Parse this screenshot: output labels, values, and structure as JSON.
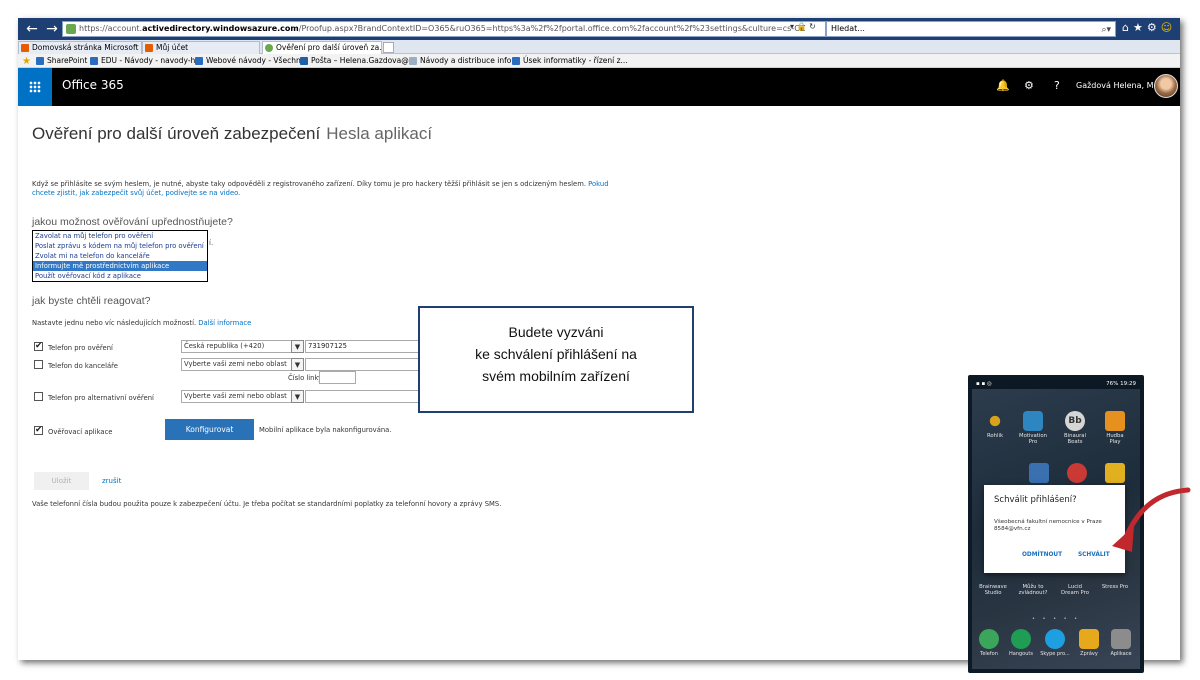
{
  "browser": {
    "url_prefix": "https://account.",
    "url_domain": "activedirectory.windowsazure.com",
    "url_rest": "/Proofup.aspx?BrandContextID=O365&ruO365=https%3a%2f%2fportal.office.com%2faccount%2f%23settings&culture=cs-CZ",
    "search_text": "Hledat...",
    "tabs": [
      {
        "label": "Domovská stránka Microsoft O..."
      },
      {
        "label": "Můj účet"
      },
      {
        "label": "Ověření pro další úroveň za..."
      }
    ],
    "favorites": [
      {
        "label": "SharePoint"
      },
      {
        "label": "EDU - Návody - navody-h..."
      },
      {
        "label": "Webové návody - Všechn..."
      },
      {
        "label": "Pošta – Helena.Gazdova@..."
      },
      {
        "label": "Návody a distribuce infor..."
      },
      {
        "label": "Úsek informatiky - řízení z..."
      }
    ]
  },
  "o365": {
    "title": "Office 365",
    "user_name": "Gaždová Helena, Mgr."
  },
  "page": {
    "title": "Ověření pro další úroveň zabezpečení",
    "title_link": "Hesla aplikací",
    "intro_text": "Když se přihlásíte se svým heslem, je nutné, abyste taky odpověděli z registrovaného zařízení. Díky tomu je pro hackery těžší přihlásit se jen s odcizeným heslem.",
    "intro_link": "Pokud chcete zjistit, jak zabezpečit svůj účet, podívejte se na video.",
    "method_heading": "jakou možnost ověřování upřednostňujete?",
    "method_options": [
      {
        "label": "Zavolat na můj telefon pro ověření"
      },
      {
        "label": "Poslat zprávu s kódem na můj telefon pro ověření"
      },
      {
        "label": "Zvolat mi na telefon do kanceláře"
      },
      {
        "label": "Informujte mě prostřednictvím aplikace"
      },
      {
        "label": "Použít ověřovací kód z aplikace"
      }
    ],
    "method_hidden_tail": "í.",
    "respond_heading": "jak byste chtěli reagovat?",
    "respond_desc": "Nastavte jednu nebo víc následujících možností.",
    "respond_link": "Další informace",
    "rows": [
      {
        "checked": "✔",
        "label": "Telefon pro ověření",
        "country": "Česká republika (+420)",
        "value": "731907125"
      },
      {
        "checked": "",
        "label": "Telefon do kanceláře",
        "country": "Vyberte vaši zemi nebo oblast",
        "value": ""
      },
      {
        "checked": "",
        "label": "Telefon pro alternativní ověření",
        "country": "Vyberte vaši zemi nebo oblast",
        "value": ""
      }
    ],
    "extension_label": "Číslo linky",
    "app_row": {
      "checked": "✔",
      "label": "Ověřovací aplikace"
    },
    "configure_label": "Konfigurovat",
    "configure_note": "Mobilní aplikace byla nakonfigurována.",
    "save_label": "Uložit",
    "cancel_label": "zrušit",
    "footer_note": "Vaše telefonní čísla budou použita pouze k zabezpečení účtu. Je třeba počítat se standardními poplatky za telefonní hovory a zprávy SMS."
  },
  "callout": {
    "line1": "Budete vyzváni",
    "line2": "ke schválení přihlášení na",
    "line3": "svém mobilním zařízení"
  },
  "phone": {
    "status_right": "76% 19:29",
    "apps": [
      {
        "label": "Rohlik"
      },
      {
        "label": "Motivation Pro"
      },
      {
        "label": "Binaural Beats"
      },
      {
        "label": "Hudba Play"
      }
    ],
    "lower_apps": [
      {
        "label": "Brainwave Studio"
      },
      {
        "label": "Můžu to zvládnout?"
      },
      {
        "label": "Lucid Dream Pro"
      },
      {
        "label": "Stress Pro"
      }
    ],
    "dock": [
      {
        "label": "Telefon"
      },
      {
        "label": "Hangouts"
      },
      {
        "label": "Skype pro..."
      },
      {
        "label": "Zprávy"
      },
      {
        "label": "Aplikace"
      }
    ],
    "dialog_title": "Schválit přihlášení?",
    "dialog_body": "Všeobecná fakultní nemocnice v Praze 8584@vfn.cz",
    "dialog_deny": "ODMÍTNOUT",
    "dialog_approve": "SCHVÁLIT"
  },
  "colors": {
    "o365_accent": "#0072c6",
    "callout_border": "#1f3f73",
    "arrow": "#c0282d"
  }
}
